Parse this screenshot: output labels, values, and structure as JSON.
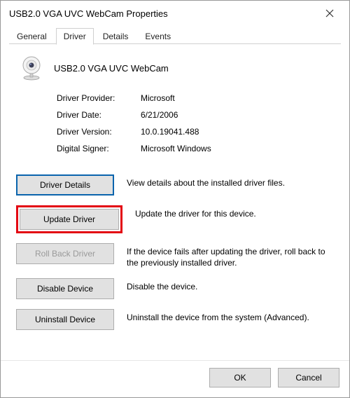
{
  "window": {
    "title": "USB2.0 VGA UVC WebCam Properties"
  },
  "tabs": {
    "general": "General",
    "driver": "Driver",
    "details": "Details",
    "events": "Events",
    "active": "driver"
  },
  "device": {
    "name": "USB2.0 VGA UVC WebCam"
  },
  "info": {
    "provider_label": "Driver Provider:",
    "provider_value": "Microsoft",
    "date_label": "Driver Date:",
    "date_value": "6/21/2006",
    "version_label": "Driver Version:",
    "version_value": "10.0.19041.488",
    "signer_label": "Digital Signer:",
    "signer_value": "Microsoft Windows"
  },
  "buttons": {
    "details": {
      "label": "Driver Details",
      "desc": "View details about the installed driver files."
    },
    "update": {
      "label": "Update Driver",
      "desc": "Update the driver for this device."
    },
    "rollback": {
      "label": "Roll Back Driver",
      "desc": "If the device fails after updating the driver, roll back to the previously installed driver."
    },
    "disable": {
      "label": "Disable Device",
      "desc": "Disable the device."
    },
    "uninstall": {
      "label": "Uninstall Device",
      "desc": "Uninstall the device from the system (Advanced)."
    }
  },
  "footer": {
    "ok": "OK",
    "cancel": "Cancel"
  }
}
